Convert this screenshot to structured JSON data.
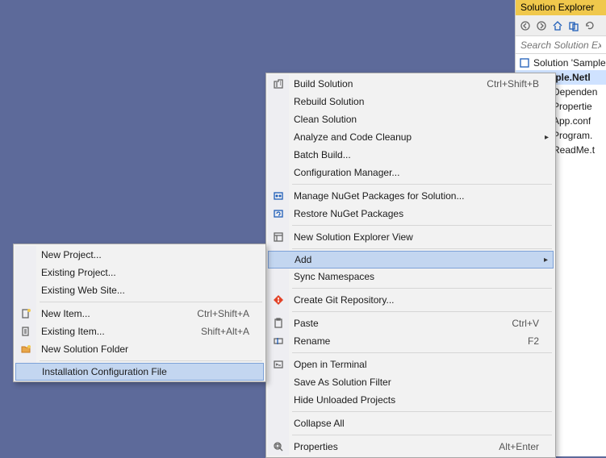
{
  "solution_explorer": {
    "title": "Solution Explorer",
    "search_placeholder": "Search Solution Explo",
    "tree": {
      "solution_label": "Solution 'Sample",
      "project_label": "ample.Netl",
      "items": [
        "Dependen",
        "Propertie",
        "App.conf",
        "Program.",
        "ReadMe.t"
      ]
    }
  },
  "main_menu": {
    "items": [
      {
        "label": "Build Solution",
        "shortcut": "Ctrl+Shift+B",
        "icon": "build-icon"
      },
      {
        "label": "Rebuild Solution"
      },
      {
        "label": "Clean Solution"
      },
      {
        "label": "Analyze and Code Cleanup",
        "submenu": true
      },
      {
        "label": "Batch Build..."
      },
      {
        "label": "Configuration Manager..."
      },
      {
        "sep": true
      },
      {
        "label": "Manage NuGet Packages for Solution...",
        "icon": "nuget-icon"
      },
      {
        "label": "Restore NuGet Packages",
        "icon": "restore-nuget-icon"
      },
      {
        "sep": true
      },
      {
        "label": "New Solution Explorer View",
        "icon": "new-view-icon"
      },
      {
        "sep": true
      },
      {
        "label": "Add",
        "submenu": true,
        "highlight": true
      },
      {
        "label": "Sync Namespaces"
      },
      {
        "sep": true
      },
      {
        "label": "Create Git Repository...",
        "icon": "git-icon"
      },
      {
        "sep": true
      },
      {
        "label": "Paste",
        "shortcut": "Ctrl+V",
        "icon": "paste-icon"
      },
      {
        "label": "Rename",
        "shortcut": "F2",
        "icon": "rename-icon"
      },
      {
        "sep": true
      },
      {
        "label": "Open in Terminal",
        "icon": "terminal-icon"
      },
      {
        "label": "Save As Solution Filter"
      },
      {
        "label": "Hide Unloaded Projects"
      },
      {
        "sep": true
      },
      {
        "label": "Collapse All"
      },
      {
        "sep": true
      },
      {
        "label": "Properties",
        "shortcut": "Alt+Enter",
        "icon": "properties-icon"
      }
    ]
  },
  "sub_menu": {
    "items": [
      {
        "label": "New Project..."
      },
      {
        "label": "Existing Project..."
      },
      {
        "label": "Existing Web Site..."
      },
      {
        "sep": true
      },
      {
        "label": "New Item...",
        "shortcut": "Ctrl+Shift+A",
        "icon": "new-item-icon"
      },
      {
        "label": "Existing Item...",
        "shortcut": "Shift+Alt+A",
        "icon": "existing-item-icon"
      },
      {
        "label": "New Solution Folder",
        "icon": "new-folder-icon"
      },
      {
        "sep": true
      },
      {
        "label": "Installation Configuration File",
        "highlight": true
      }
    ]
  }
}
